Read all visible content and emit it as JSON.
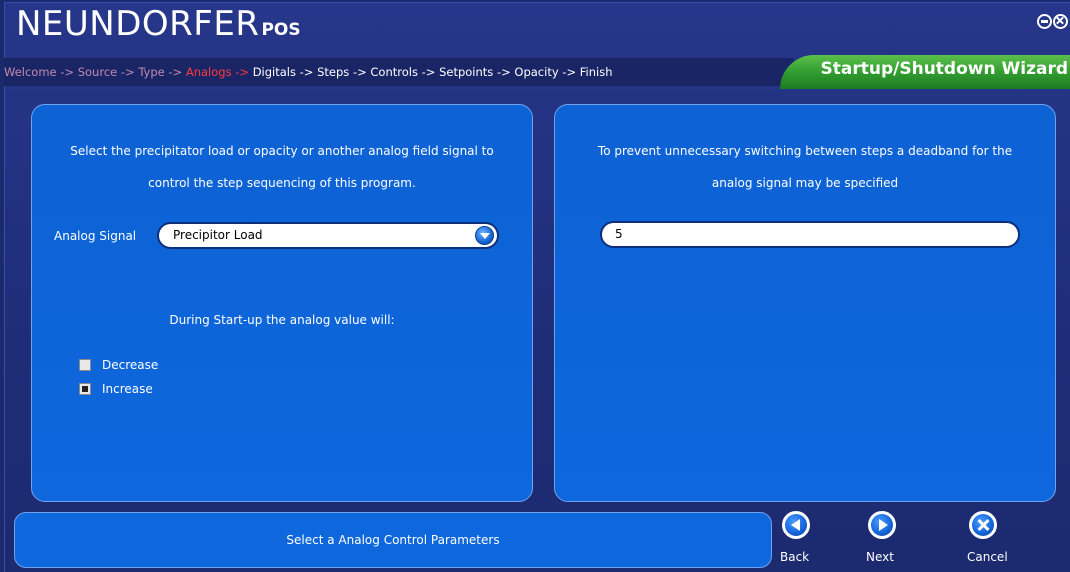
{
  "app": {
    "title": "NEUNDORFER",
    "title_suffix": "POS"
  },
  "breadcrumb": {
    "steps": [
      "Welcome",
      "Source",
      "Type",
      "Analogs",
      "Digitals",
      "Steps",
      "Controls",
      "Setpoints",
      "Opacity",
      "Finish"
    ],
    "separator": " -> ",
    "active_index": 3
  },
  "wizard_title": "Startup/Shutdown Wizard",
  "left_panel": {
    "description_line1": "Select the precipitator load or opacity or another analog field signal to",
    "description_line2": "control the step sequencing of this program.",
    "analog_signal_label": "Analog Signal",
    "analog_signal_value": "Precipitor Load",
    "during_label": "During Start-up the analog value will:",
    "options": [
      {
        "label": "Decrease",
        "checked": false
      },
      {
        "label": "Increase",
        "checked": true
      }
    ]
  },
  "right_panel": {
    "description_line1": "To prevent unnecessary switching between steps a deadband for the",
    "description_line2": "analog signal may be specified",
    "deadband_value": "5"
  },
  "status": {
    "message": "Select a Analog Control Parameters"
  },
  "nav": {
    "back": "Back",
    "next": "Next",
    "cancel": "Cancel"
  },
  "colors": {
    "background": "#1f2d78",
    "panel": "#0e67dd",
    "active_step": "#ff3a3a",
    "done_step": "#c08ab0",
    "wizard_tab": "#2f9a2f"
  }
}
